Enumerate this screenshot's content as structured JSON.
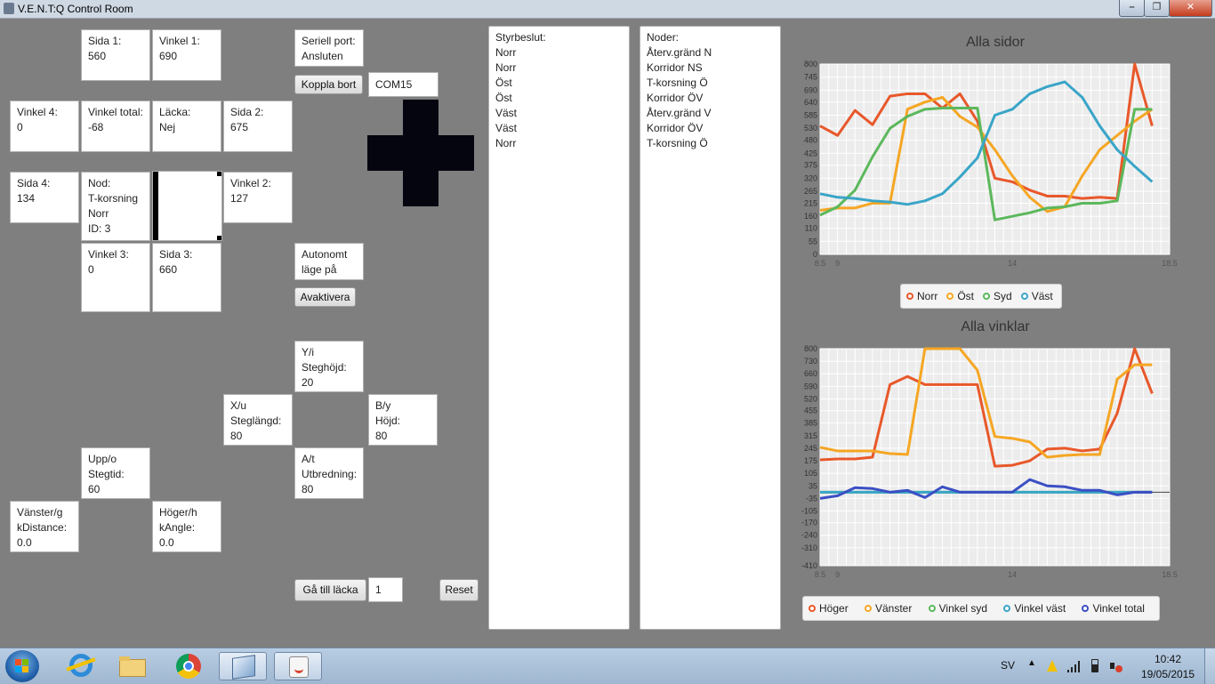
{
  "window": {
    "title": "V.E.N.T:Q Control Room",
    "min": "–",
    "max": "❐",
    "close": "✕"
  },
  "cells": {
    "sida1": "Sida 1:\n560",
    "vinkel1": "Vinkel 1:\n690",
    "vinkel4": "Vinkel 4:\n0",
    "vinkel_total": "Vinkel total:\n-68",
    "lacka": "Läcka:\nNej",
    "sida2": "Sida 2:\n675",
    "sida4": "Sida 4:\n134",
    "nod": "Nod:\nT-korsning\nNorr\nID: 3",
    "vinkel2": "Vinkel 2:\n127",
    "vinkel3": "Vinkel 3:\n0",
    "sida3": "Sida 3:\n660",
    "seriell": "Seriell port:\nAnsluten",
    "autonomt": "Autonomt\nläge på",
    "yi": "Y/i\nSteghöjd:\n20",
    "xu": "X/u\nSteglängd:\n80",
    "by": "B/y\nHöjd:\n80",
    "at": "A/t\nUtbredning:\n80",
    "uppo": "Upp/o\nStegtid:\n60",
    "vanster": "Vänster/g\nkDistance:\n0.0",
    "hoger": "Höger/h\nkAngle:\n0.0"
  },
  "controls": {
    "koppla_bort": "Koppla bort",
    "com_port": "COM15",
    "avaktivera": "Avaktivera",
    "ga_till_lacka": "Gå till läcka",
    "leak_id": "1",
    "reset": "Reset"
  },
  "styrbeslut": {
    "header": "Styrbeslut:",
    "items": [
      "Norr",
      "Norr",
      "Öst",
      "Öst",
      "Väst",
      "Väst",
      "Norr"
    ]
  },
  "noder": {
    "header": "Noder:",
    "items": [
      "Återv.gränd N",
      "Korridor NS",
      "T-korsning Ö",
      "Korridor ÖV",
      "Återv.gränd V",
      "Korridor ÖV",
      "T-korsning Ö"
    ]
  },
  "chart_data": [
    {
      "type": "line",
      "title": "Alla sidor",
      "xlim": [
        8.5,
        18.5
      ],
      "ylim": [
        0,
        800
      ],
      "x_ticks": [
        "8.5",
        "9",
        "14",
        "18.5"
      ],
      "y_ticks": [
        0,
        55,
        110,
        160,
        215,
        265,
        320,
        375,
        425,
        480,
        530,
        585,
        640,
        690,
        745,
        800
      ],
      "x": [
        8.5,
        9,
        9.5,
        10,
        10.5,
        11,
        11.5,
        12,
        12.5,
        13,
        13.5,
        14,
        14.5,
        15,
        15.5,
        16,
        16.5,
        17,
        17.5,
        18
      ],
      "series": [
        {
          "name": "Norr",
          "color": "#e8582a",
          "values": [
            540,
            500,
            605,
            545,
            665,
            675,
            675,
            615,
            675,
            560,
            320,
            305,
            270,
            245,
            245,
            235,
            240,
            235,
            800,
            540
          ]
        },
        {
          "name": "Öst",
          "color": "#f5a623",
          "values": [
            185,
            195,
            195,
            215,
            215,
            610,
            640,
            660,
            580,
            535,
            440,
            330,
            240,
            180,
            200,
            330,
            440,
            500,
            560,
            610
          ]
        },
        {
          "name": "Syd",
          "color": "#5cb85c",
          "values": [
            165,
            200,
            270,
            410,
            530,
            580,
            610,
            615,
            615,
            615,
            145,
            160,
            175,
            195,
            200,
            215,
            215,
            225,
            610,
            610
          ]
        },
        {
          "name": "Väst",
          "color": "#3aa5c8",
          "values": [
            255,
            240,
            235,
            225,
            220,
            210,
            225,
            255,
            325,
            405,
            585,
            610,
            675,
            705,
            725,
            660,
            540,
            440,
            370,
            305
          ]
        }
      ]
    },
    {
      "type": "line",
      "title": "Alla vinklar",
      "xlim": [
        8.5,
        18.5
      ],
      "ylim": [
        -410,
        800
      ],
      "x_ticks": [
        "8.5",
        "9",
        "14",
        "18.5"
      ],
      "y_ticks": [
        800,
        730,
        660,
        590,
        520,
        455,
        385,
        315,
        245,
        175,
        105,
        35,
        -35,
        -105,
        -170,
        -240,
        -310,
        -410
      ],
      "x": [
        8.5,
        9,
        9.5,
        10,
        10.5,
        11,
        11.5,
        12,
        12.5,
        13,
        13.5,
        14,
        14.5,
        15,
        15.5,
        16,
        16.5,
        17,
        17.5,
        18
      ],
      "series": [
        {
          "name": "Höger",
          "color": "#e8582a",
          "values": [
            180,
            185,
            185,
            195,
            600,
            645,
            600,
            600,
            600,
            600,
            145,
            150,
            175,
            240,
            245,
            230,
            240,
            440,
            800,
            550
          ]
        },
        {
          "name": "Vänster",
          "color": "#f5a623",
          "values": [
            250,
            230,
            230,
            230,
            215,
            210,
            800,
            800,
            800,
            680,
            310,
            300,
            280,
            195,
            205,
            210,
            210,
            630,
            710,
            710
          ]
        },
        {
          "name": "Vinkel syd",
          "color": "#5cb85c",
          "values": [
            0,
            0,
            0,
            0,
            0,
            0,
            0,
            0,
            0,
            0,
            0,
            0,
            0,
            0,
            0,
            0,
            0,
            0,
            0,
            0
          ]
        },
        {
          "name": "Vinkel väst",
          "color": "#3aa5c8",
          "values": [
            0,
            0,
            0,
            0,
            0,
            0,
            0,
            0,
            0,
            0,
            0,
            0,
            0,
            0,
            0,
            0,
            0,
            0,
            0,
            0
          ]
        },
        {
          "name": "Vinkel total",
          "color": "#3b4fc4",
          "values": [
            -35,
            -20,
            25,
            20,
            0,
            10,
            -30,
            30,
            0,
            0,
            0,
            0,
            70,
            35,
            30,
            10,
            10,
            -15,
            0,
            0
          ]
        }
      ]
    }
  ],
  "taskbar": {
    "lang": "SV",
    "time": "10:42",
    "date": "19/05/2015",
    "icons": [
      "start-orb-icon",
      "internet-explorer-icon",
      "file-explorer-icon",
      "chrome-icon",
      "virtualbox-icon",
      "java-icon"
    ]
  }
}
